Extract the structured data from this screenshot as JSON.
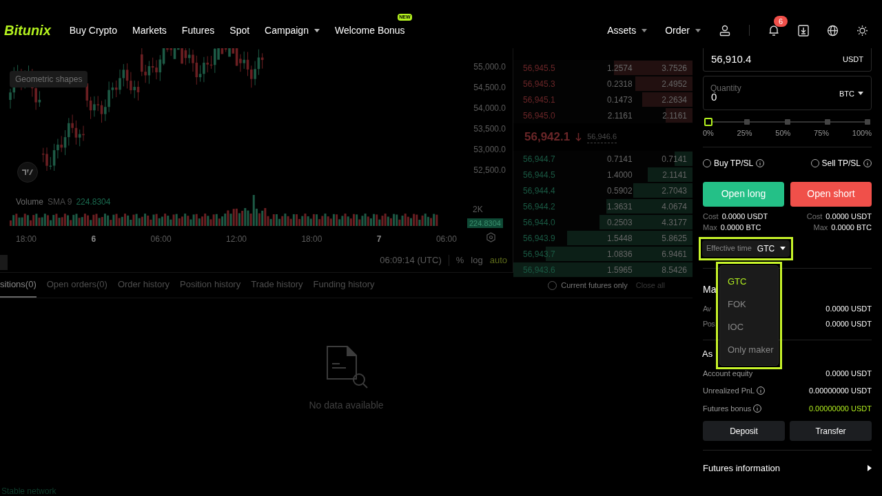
{
  "header": {
    "logo": "Bitunix",
    "nav": [
      {
        "label": "Buy Crypto",
        "kind": "link"
      },
      {
        "label": "Markets",
        "kind": "link"
      },
      {
        "label": "Futures",
        "kind": "link"
      },
      {
        "label": "Spot",
        "kind": "link"
      },
      {
        "label": "Campaign",
        "kind": "menu"
      },
      {
        "label": "Welcome Bonus",
        "kind": "link",
        "badge": "NEW"
      }
    ],
    "right_menus": [
      "Assets",
      "Order"
    ],
    "notification_count": "6"
  },
  "chart": {
    "tooltip": "Geometric shapes",
    "price_labels": [
      "55,000.0",
      "54,500.0",
      "54,000.0",
      "53,500.0",
      "53,000.0",
      "52,500.0"
    ],
    "volume": {
      "label": "Volume",
      "indicator": "SMA 9",
      "value": "224.8304",
      "axis_label": "2K",
      "tag": "224.8304"
    },
    "time_labels": [
      {
        "label": "18:00",
        "bold": false
      },
      {
        "label": "6",
        "bold": true
      },
      {
        "label": "06:00",
        "bold": false
      },
      {
        "label": "12:00",
        "bold": false
      },
      {
        "label": "18:00",
        "bold": false
      },
      {
        "label": "7",
        "bold": true
      },
      {
        "label": "06:00",
        "bold": false
      }
    ],
    "clock": "06:09:14 (UTC)",
    "scale_options": [
      {
        "label": "%",
        "selected": false
      },
      {
        "label": "log",
        "selected": false
      },
      {
        "label": "auto",
        "selected": true
      }
    ]
  },
  "order_book": {
    "asks": [
      {
        "price": "56,945.5",
        "size": "1.2574",
        "total": "3.7526",
        "level": 0.44
      },
      {
        "price": "56,945.3",
        "size": "0.2318",
        "total": "2.4952",
        "level": 0.32
      },
      {
        "price": "56,945.1",
        "size": "0.1473",
        "total": "2.2634",
        "level": 0.28
      },
      {
        "price": "56,945.0",
        "size": "2.1161",
        "total": "2.1161",
        "level": 0.15
      }
    ],
    "last_price": "56,942.1",
    "mark_price": "56,946.6",
    "bids": [
      {
        "price": "56,944.7",
        "size": "0.7141",
        "total": "0.7141",
        "level": 0.1
      },
      {
        "price": "56,944.5",
        "size": "1.4000",
        "total": "2.1141",
        "level": 0.25
      },
      {
        "price": "56,944.4",
        "size": "0.5902",
        "total": "2.7043",
        "level": 0.33
      },
      {
        "price": "56,944.2",
        "size": "1.3631",
        "total": "4.0674",
        "level": 0.48
      },
      {
        "price": "56,944.0",
        "size": "0.2503",
        "total": "4.3177",
        "level": 0.52
      },
      {
        "price": "56,943.9",
        "size": "1.5448",
        "total": "5.8625",
        "level": 0.7
      },
      {
        "price": "56,943.7",
        "size": "1.0836",
        "total": "6.9461",
        "level": 0.82
      },
      {
        "price": "56,943.6",
        "size": "1.5965",
        "total": "8.5426",
        "level": 1
      }
    ]
  },
  "order_form": {
    "price": {
      "value": "56,910.4",
      "unit": "USDT"
    },
    "quantity": {
      "label": "Quantity",
      "value": "0",
      "unit": "BTC"
    },
    "slider": {
      "level": 0,
      "marks": [
        "0%",
        "25%",
        "50%",
        "75%",
        "100%"
      ]
    },
    "tpsl": [
      {
        "label": "Buy TP/SL",
        "checked": false
      },
      {
        "label": "Sell TP/SL",
        "checked": false
      }
    ],
    "buttons": [
      {
        "label": "Open long",
        "kind": "long"
      },
      {
        "label": "Open short",
        "kind": "short"
      }
    ],
    "summary": [
      [
        {
          "label": "Cost",
          "value": "0.0000 USDT"
        },
        {
          "label": "Max",
          "value": "0.0000 BTC"
        }
      ],
      [
        {
          "label": "Cost",
          "value": "0.0000 USDT"
        },
        {
          "label": "Max",
          "value": "0.0000 BTC"
        }
      ]
    ],
    "effective_time": {
      "label": "Effective time",
      "value": "GTC",
      "expanded": true,
      "options": [
        {
          "label": "GTC",
          "selected": true
        },
        {
          "label": "FOK",
          "selected": false
        },
        {
          "label": "IOC",
          "selected": false
        },
        {
          "label": "Only maker",
          "selected": false
        }
      ]
    }
  },
  "margin": {
    "title": "Ma",
    "rows": [
      {
        "label": "Av",
        "value": "0.0000 USDT"
      },
      {
        "label": "Pos",
        "value": "0.0000 USDT"
      }
    ]
  },
  "assets": {
    "title": "As",
    "rows": [
      {
        "label": "Account equity",
        "value": "0.0000 USDT",
        "kind": "plain",
        "highlight": false
      },
      {
        "label": "Unrealized PnL",
        "value": "0.00000000 USDT",
        "kind": "info",
        "highlight": false
      },
      {
        "label": "Futures bonus",
        "value": "0.00000000 USDT",
        "kind": "info",
        "highlight": true
      }
    ],
    "buttons": [
      "Deposit",
      "Transfer"
    ],
    "futures_info": "Futures information"
  },
  "positions": {
    "tabs": [
      {
        "label": "sitions(0)",
        "selected": true
      },
      {
        "label": "Open orders(0)",
        "selected": false
      },
      {
        "label": "Order history",
        "selected": false
      },
      {
        "label": "Position history",
        "selected": false
      },
      {
        "label": "Trade history",
        "selected": false
      },
      {
        "label": "Funding history",
        "selected": false
      }
    ],
    "current_only": {
      "label": "Current futures only",
      "checked": false
    },
    "close_all": "Close all",
    "empty": "No data available"
  },
  "status": "Stable network"
}
